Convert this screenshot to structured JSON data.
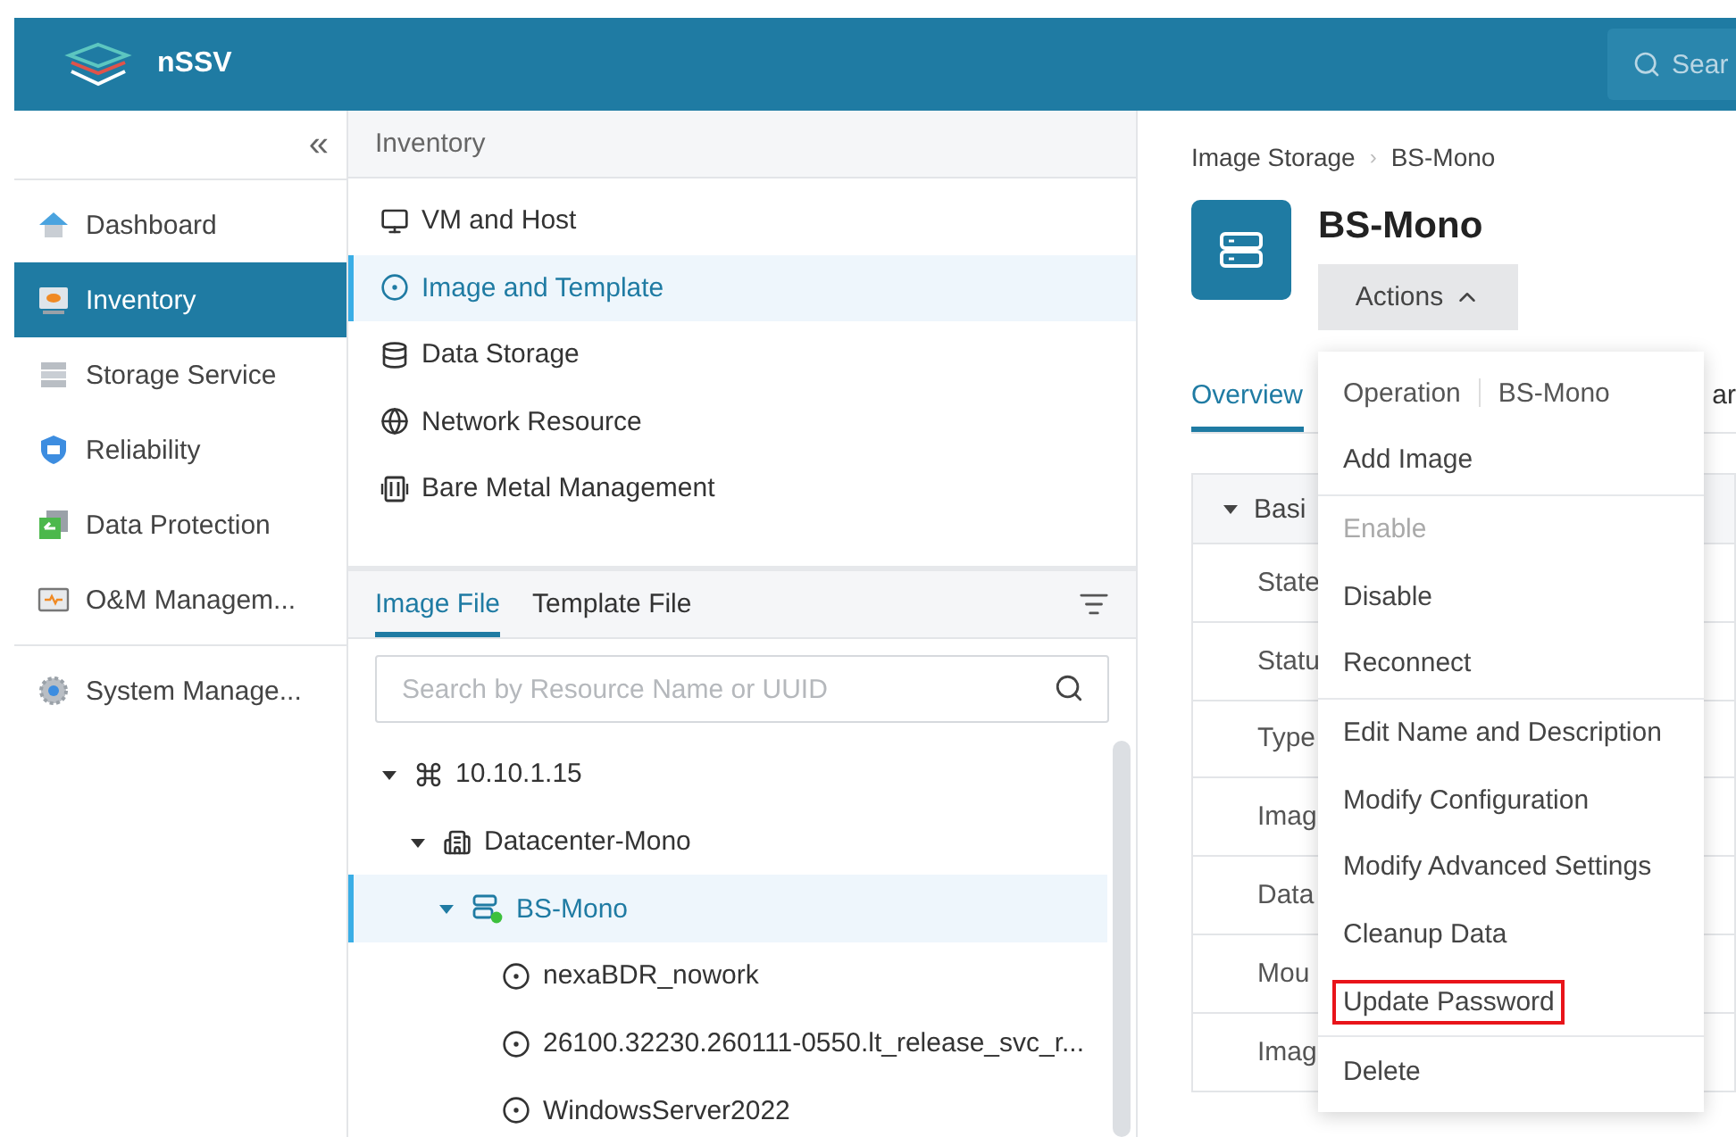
{
  "header": {
    "brand": "nSSV",
    "search": {
      "placeholder": "Sear"
    }
  },
  "sidebar": {
    "collapse": "«",
    "groups": [
      [
        {
          "label": "Dashboard",
          "kind": "home",
          "selected": false
        },
        {
          "label": "Inventory",
          "kind": "inventory",
          "selected": true
        },
        {
          "label": "Storage Service",
          "kind": "storage",
          "selected": false
        },
        {
          "label": "Reliability",
          "kind": "shield",
          "selected": false
        },
        {
          "label": "Data Protection",
          "kind": "protection",
          "selected": false
        },
        {
          "label": "O&M Managem...",
          "kind": "monitor",
          "selected": false
        }
      ],
      [
        {
          "label": "System Manage...",
          "kind": "gear",
          "selected": false
        }
      ]
    ]
  },
  "inventory": {
    "title": "Inventory",
    "items": [
      {
        "label": "VM and Host",
        "kind": "monitor",
        "selected": false
      },
      {
        "label": "Image and Template",
        "kind": "image",
        "selected": true
      },
      {
        "label": "Data Storage",
        "kind": "database",
        "selected": false
      },
      {
        "label": "Network Resource",
        "kind": "globe",
        "selected": false
      },
      {
        "label": "Bare Metal Management",
        "kind": "baremetal",
        "selected": false
      }
    ],
    "tabs": [
      {
        "label": "Image File",
        "selected": true
      },
      {
        "label": "Template File",
        "selected": false
      }
    ],
    "search": {
      "placeholder": "Search by Resource Name or UUID"
    },
    "tree": [
      {
        "label": "10.10.1.15",
        "kind": "zone",
        "expanded": true,
        "selected": false,
        "children": [
          {
            "label": "Datacenter-Mono",
            "kind": "datacenter",
            "expanded": true,
            "selected": false,
            "children": [
              {
                "label": "BS-Mono",
                "kind": "storage",
                "expanded": true,
                "selected": true,
                "children": [
                  {
                    "label": "nexaBDR_nowork",
                    "kind": "image",
                    "selected": false
                  },
                  {
                    "label": "26100.32230.260111-0550.lt_release_svc_r...",
                    "kind": "image",
                    "selected": false
                  },
                  {
                    "label": "WindowsServer2022",
                    "kind": "image",
                    "selected": false
                  }
                ]
              }
            ]
          }
        ]
      }
    ]
  },
  "detail": {
    "breadcrumb": [
      "Image Storage",
      "BS-Mono"
    ],
    "breadcrumb_separator": "›",
    "title": "BS-Mono",
    "actions": {
      "label": "Actions",
      "expanded": true
    },
    "tabs": [
      {
        "label": "Overview",
        "selected": true
      },
      {
        "label": "ar",
        "selected": false
      }
    ],
    "section": {
      "label": "Basi",
      "expanded": true
    },
    "rows": [
      "State",
      "Statu",
      "Type",
      "Imag",
      "Data",
      "Mou",
      "Imag"
    ],
    "menu": {
      "header": {
        "label": "Operation",
        "target": "BS-Mono"
      },
      "groups": [
        [
          {
            "label": "Add Image",
            "disabled": false,
            "highlighted": false
          }
        ],
        [
          {
            "label": "Enable",
            "disabled": true,
            "highlighted": false
          },
          {
            "label": "Disable",
            "disabled": false,
            "highlighted": false
          },
          {
            "label": "Reconnect",
            "disabled": false,
            "highlighted": false
          }
        ],
        [
          {
            "label": "Edit Name and Description",
            "disabled": false,
            "highlighted": false
          },
          {
            "label": "Modify Configuration",
            "disabled": false,
            "highlighted": false
          },
          {
            "label": "Modify Advanced Settings",
            "disabled": false,
            "highlighted": false
          },
          {
            "label": "Cleanup Data",
            "disabled": false,
            "highlighted": false
          },
          {
            "label": "Update Password",
            "disabled": false,
            "highlighted": true
          }
        ],
        [
          {
            "label": "Delete",
            "disabled": false,
            "highlighted": false
          }
        ]
      ]
    }
  }
}
